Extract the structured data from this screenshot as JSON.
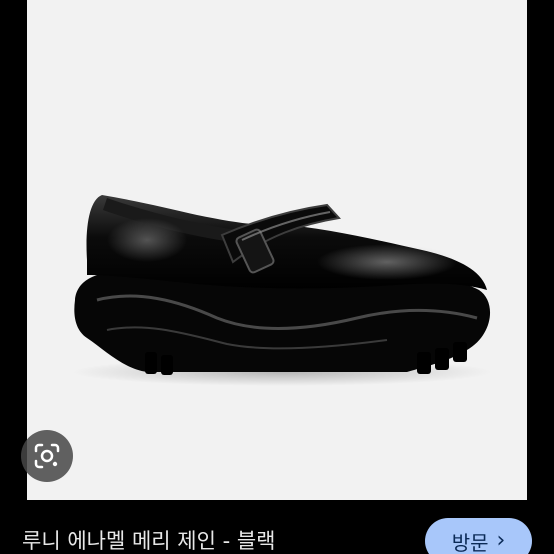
{
  "result": {
    "image_alt": "루니 에나멜 메리 제인 - 블랙",
    "title": "루니 에나멜 메리 제인 - 블랙",
    "visit_label": "방문",
    "visit_chevron": "›"
  },
  "icons": {
    "lens": "google-lens-icon",
    "chevron": "chevron-right-icon"
  },
  "colors": {
    "page_background": "#000000",
    "photo_background": "#f2f2f2",
    "visit_button": "#a8c7fa",
    "visit_text": "#0b2a56",
    "title_text": "#e8e8e8"
  }
}
